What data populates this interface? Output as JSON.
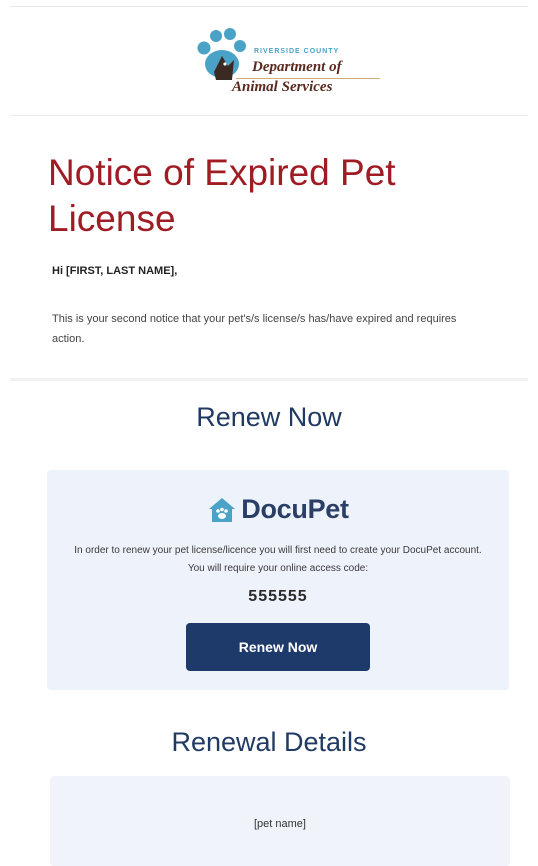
{
  "header": {
    "logo_county": "RIVERSIDE COUNTY",
    "logo_line1": "Department of",
    "logo_line2": "Animal Services",
    "paw_color": "#4aa3c7",
    "brand_dark": "#5a2a1f"
  },
  "notice": {
    "title": "Notice of Expired Pet License",
    "greeting": "Hi [FIRST, LAST NAME],",
    "body": "This is your second notice that your pet's/s license/s has/have expired and requires action.",
    "title_color": "#a01c25"
  },
  "renew": {
    "heading": "Renew Now",
    "brand_name": "DocuPet",
    "brand_icon": "house-paw-icon",
    "instructions": "In order to renew your pet license/licence you will first need to create your DocuPet account. You will require your online access code:",
    "access_code": "555555",
    "button_label": "Renew Now",
    "button_color": "#1e3a6a"
  },
  "details": {
    "heading": "Renewal Details",
    "pet_name": "[pet name]"
  }
}
